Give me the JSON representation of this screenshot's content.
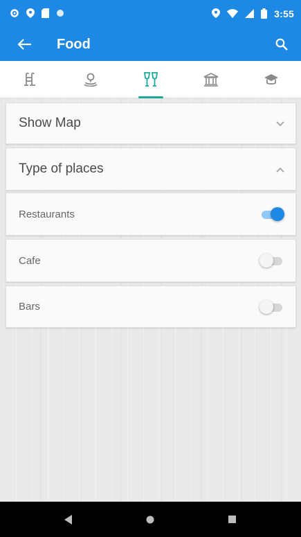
{
  "status_bar": {
    "time": "3:55",
    "icons_left": [
      "settings-icon",
      "location-icon",
      "sim-card-icon",
      "circle-icon"
    ],
    "icons_right": [
      "location-icon",
      "wifi-icon",
      "signal-icon",
      "battery-icon"
    ]
  },
  "app_bar": {
    "title": "Food",
    "color": "#1e88e5"
  },
  "tabs": [
    {
      "icon": "pool-ladder-icon",
      "active": false
    },
    {
      "icon": "map-pin-person-icon",
      "active": false
    },
    {
      "icon": "food-drink-icon",
      "active": true
    },
    {
      "icon": "museum-icon",
      "active": false
    },
    {
      "icon": "graduation-cap-icon",
      "active": false
    }
  ],
  "accent_color": "#1aa89a",
  "show_map": {
    "label": "Show Map",
    "expanded": false
  },
  "type_of_places": {
    "label": "Type of places",
    "expanded": true,
    "items": [
      {
        "label": "Restaurants",
        "enabled": true
      },
      {
        "label": "Cafe",
        "enabled": false
      },
      {
        "label": "Bars",
        "enabled": false
      }
    ]
  },
  "nav_bar": {
    "buttons": [
      "back-triangle-icon",
      "home-circle-icon",
      "recents-square-icon"
    ]
  }
}
